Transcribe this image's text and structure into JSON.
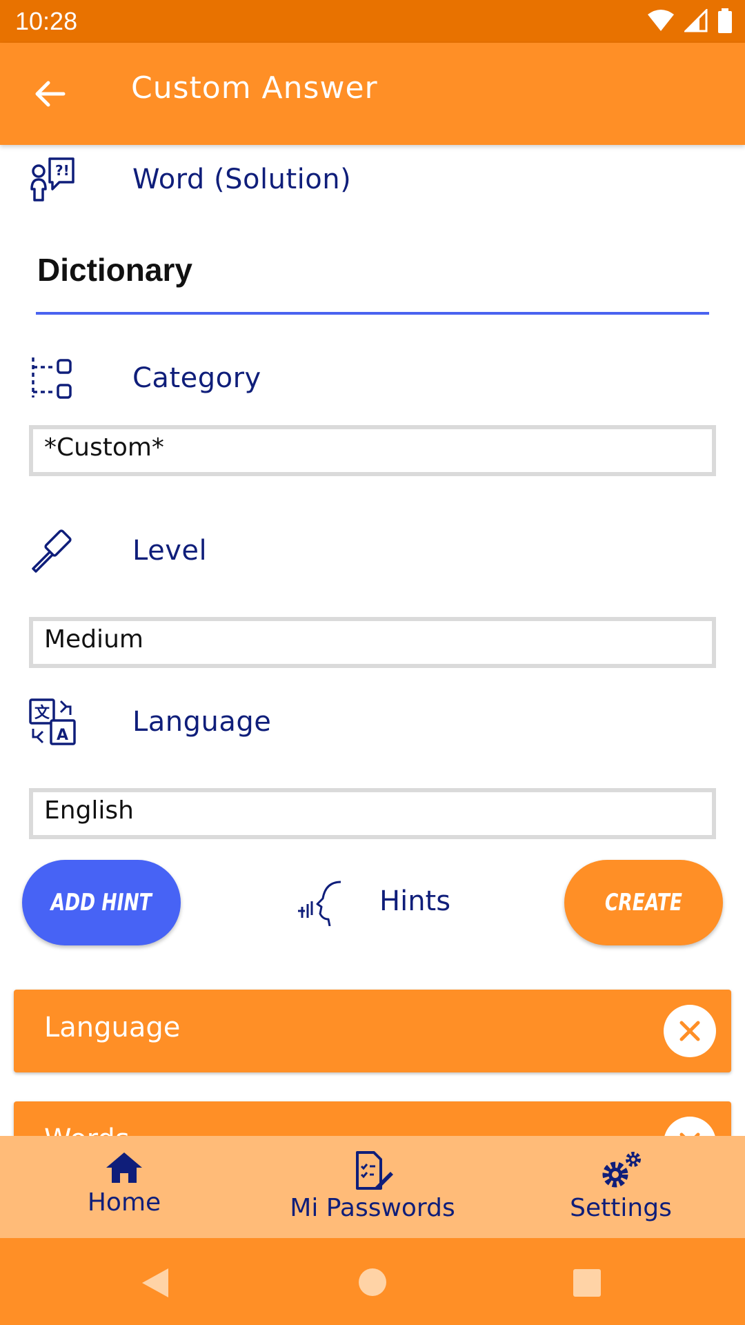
{
  "status_bar": {
    "time": "10:28"
  },
  "app_bar": {
    "title": "Custom Answer"
  },
  "form": {
    "word_label": "Word (Solution)",
    "word_value": "Dictionary",
    "category_label": "Category",
    "category_value": "*Custom*",
    "level_label": "Level",
    "level_value": "Medium",
    "language_label": "Language",
    "language_value": "English"
  },
  "actions": {
    "add_hint": "ADD HINT",
    "hints_label": "Hints",
    "create": "CREATE"
  },
  "hints": [
    {
      "label": "Language"
    },
    {
      "label": "Words"
    }
  ],
  "bottom_nav": {
    "items": [
      {
        "label": "Home",
        "icon": "home-icon"
      },
      {
        "label": "Mi Passwords",
        "icon": "clipboard-edit-icon"
      },
      {
        "label": "Settings",
        "icon": "gears-icon"
      }
    ]
  },
  "colors": {
    "primary": "#FF8F26",
    "status_bar": "#E87200",
    "accent_blue": "#4763F5",
    "label_navy": "#0F1E7A",
    "bottom_nav_bg": "#FFBB78"
  }
}
